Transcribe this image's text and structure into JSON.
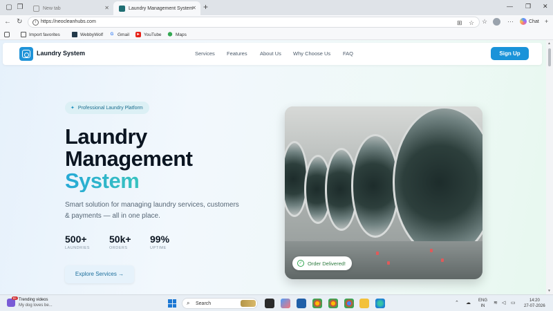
{
  "browser": {
    "tabs": [
      {
        "label": "New tab",
        "active": false
      },
      {
        "label": "Laundry Management System",
        "active": true
      }
    ],
    "url": "https://neocleanhubs.com",
    "chat_label": "Chat",
    "bookmarks": [
      {
        "label": "Import favorites",
        "icon": "import-icon"
      },
      {
        "label": "WebbyWolf",
        "icon": "webbywolf-icon"
      },
      {
        "label": "Gmail",
        "icon": "google-icon"
      },
      {
        "label": "YouTube",
        "icon": "youtube-icon"
      },
      {
        "label": "Maps",
        "icon": "maps-icon"
      }
    ]
  },
  "site": {
    "brand": "Laundry System",
    "nav": [
      "Services",
      "Features",
      "About Us",
      "Why Choose Us",
      "FAQ"
    ],
    "signup_label": "Sign Up",
    "accent_color": "#1a93d9"
  },
  "hero": {
    "badge": "Professional Laundry Platform",
    "title_line1": "Laundry",
    "title_line2": "Management",
    "title_line3": "System",
    "subtitle": "Smart solution for managing laundry services, customers & payments — all in one place.",
    "stats": [
      {
        "value": "500+",
        "label": "LAUNDRIES"
      },
      {
        "value": "50k+",
        "label": "ORDERS"
      },
      {
        "value": "99%",
        "label": "UPTIME"
      }
    ],
    "cta_label": "Explore Services",
    "cta_arrow": "→",
    "image_badge": "Order Delivered!"
  },
  "taskbar": {
    "trending_title": "Trending videos",
    "trending_sub": "My dog loves be...",
    "notification_count": "9+",
    "search_label": "Search",
    "lang_line1": "ENG",
    "lang_line2": "IN",
    "time": "14:20",
    "date": "27-07-2026"
  }
}
